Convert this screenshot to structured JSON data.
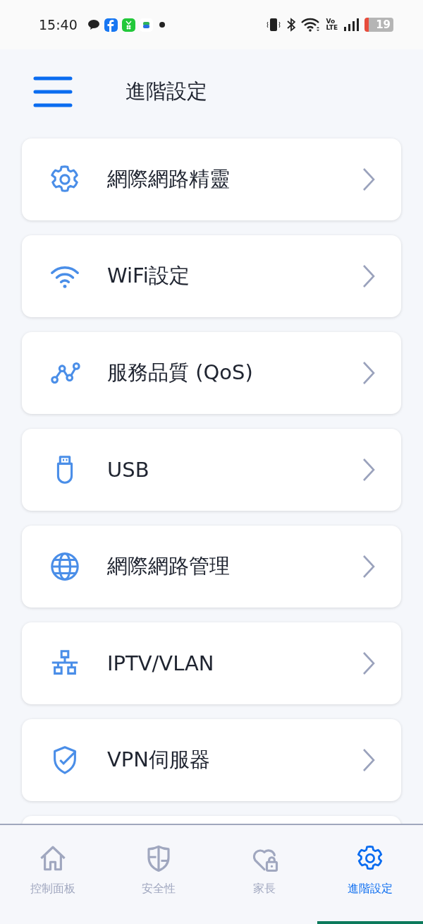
{
  "status_bar": {
    "time": "15:40",
    "network_label_top": "Vo",
    "network_label_bottom": "LTE",
    "battery": "19"
  },
  "header": {
    "title": "進階設定"
  },
  "menu": [
    {
      "label": "網際網路精靈",
      "kind": "gear"
    },
    {
      "label": "WiFi設定",
      "kind": "wifi"
    },
    {
      "label": "服務品質 (QoS)",
      "kind": "graph"
    },
    {
      "label": "USB",
      "kind": "usb"
    },
    {
      "label": "網際網路管理",
      "kind": "globe"
    },
    {
      "label": "IPTV/VLAN",
      "kind": "network"
    },
    {
      "label": "VPN伺服器",
      "kind": "shield"
    }
  ],
  "bottom_nav": [
    {
      "label": "控制面板",
      "kind": "home",
      "selected": false
    },
    {
      "label": "安全性",
      "kind": "shield",
      "selected": false
    },
    {
      "label": "家長",
      "kind": "heartlock",
      "selected": false
    },
    {
      "label": "進階設定",
      "kind": "gear",
      "selected": true
    }
  ]
}
